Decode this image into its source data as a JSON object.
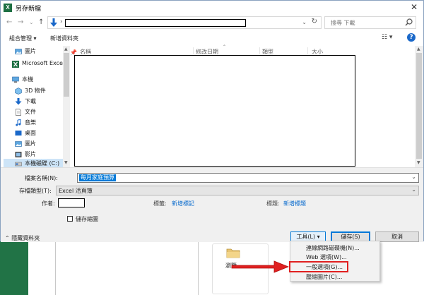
{
  "window": {
    "title": "另存新檔",
    "app_icon_letter": "X",
    "close_label": "✕"
  },
  "nav": {
    "back": "←",
    "forward": "→",
    "dropdown": "⌄",
    "up": "↑",
    "address_chevron": "›",
    "address_dropdown": "⌄",
    "refresh": "↻",
    "search_placeholder": "搜尋 下載"
  },
  "commands": {
    "organize": "組合管理 ▾",
    "new_folder": "新增資料夾",
    "view": "☷ ▾",
    "help": "?"
  },
  "sidebar": {
    "items": [
      {
        "label": "圖片",
        "icon": "picture-icon"
      },
      {
        "label": "Microsoft Excel",
        "icon": "excel-icon"
      },
      {
        "label": "本機",
        "icon": "pc-icon"
      },
      {
        "label": "3D 物件",
        "icon": "3d-objects-icon"
      },
      {
        "label": "下載",
        "icon": "download-icon"
      },
      {
        "label": "文件",
        "icon": "document-icon"
      },
      {
        "label": "音樂",
        "icon": "music-icon"
      },
      {
        "label": "桌面",
        "icon": "desktop-icon"
      },
      {
        "label": "圖片",
        "icon": "picture-icon"
      },
      {
        "label": "影片",
        "icon": "video-icon"
      },
      {
        "label": "本機磁碟 (C:)",
        "icon": "drive-icon"
      }
    ],
    "pin": "📌"
  },
  "columns": [
    "名稱",
    "修改日期",
    "類型",
    "大小"
  ],
  "form": {
    "filename_label": "檔案名稱(N):",
    "filename_value": "每月家庭預算",
    "filetype_label": "存檔類型(T):",
    "filetype_value": "Excel 活頁簿",
    "author_label": "作者:",
    "tags_label": "標籤:",
    "tags_link": "新增標記",
    "title_label": "標題:",
    "title_link": "新增標題",
    "thumbnail_label": "儲存縮圖",
    "hide_folders": "隱藏資料夾",
    "tools_button": "工具(L)  ▾",
    "save_button": "儲存(S)",
    "cancel_button": "取消"
  },
  "tools_menu": {
    "items": [
      "連線網路磁碟機(N)...",
      "Web 選項(W)...",
      "一般選項(G)...",
      "壓縮圖片(C)..."
    ],
    "highlighted_index": 2
  },
  "background": {
    "browse_label": "瀏覽"
  },
  "colors": {
    "accent": "#0078d7",
    "excel_green": "#217346",
    "highlight_red": "#e02020",
    "link_blue": "#0066cc"
  }
}
